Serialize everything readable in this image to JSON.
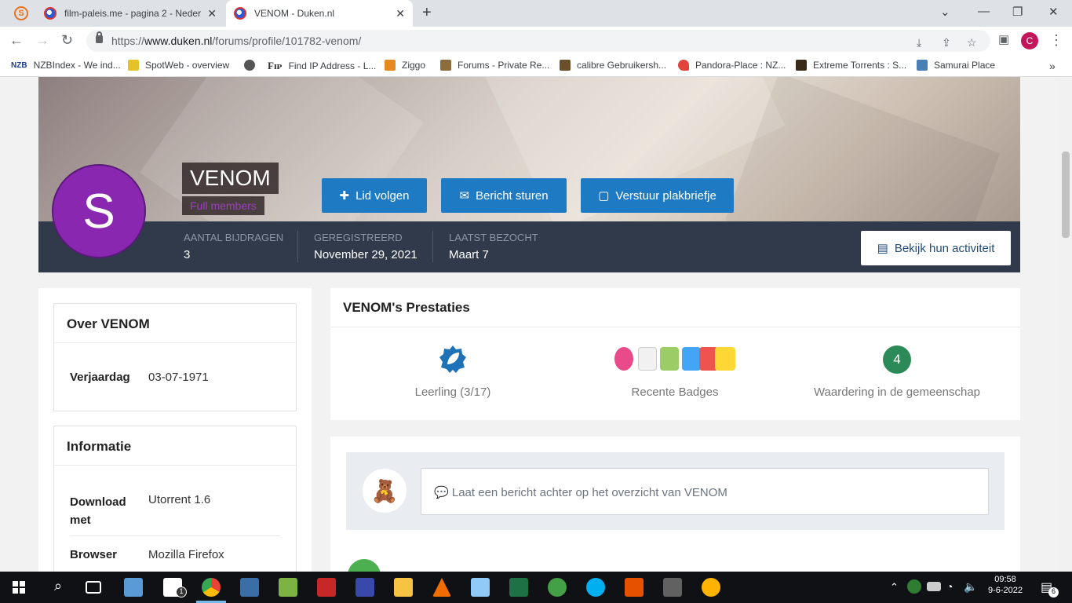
{
  "browser": {
    "tabs": [
      {
        "title": "film-paleis.me - pagina 2 - Neder",
        "active": false
      },
      {
        "title": "VENOM - Duken.nl",
        "active": true
      }
    ],
    "url_prefix": "https://",
    "url_host": "www.duken.nl",
    "url_path": "/forums/profile/101782-venom/",
    "profile_initial": "C",
    "bookmarks": [
      {
        "label": "NZBIndex - We ind...",
        "icon": "nzb-icon",
        "color": "#1a3e8c"
      },
      {
        "label": "SpotWeb - overview",
        "icon": "pencil-icon",
        "color": "#e6c229"
      },
      {
        "label": "",
        "icon": "globe-icon",
        "color": "#555555"
      },
      {
        "label": "Find IP Address - L...",
        "icon": "fip-icon",
        "color": "#333333"
      },
      {
        "label": "Ziggo",
        "icon": "ziggo-icon",
        "color": "#e58a1f"
      },
      {
        "label": "Forums - Private Re...",
        "icon": "forums-icon",
        "color": "#8a6d3b"
      },
      {
        "label": "calibre Gebruikersh...",
        "icon": "books-icon",
        "color": "#6b4f2a"
      },
      {
        "label": "Pandora-Place : NZ...",
        "icon": "heart-icon",
        "color": "#e0443a"
      },
      {
        "label": "Extreme Torrents : S...",
        "icon": "extreme-icon",
        "color": "#3a2a1a"
      },
      {
        "label": "Samurai Place",
        "icon": "samurai-icon",
        "color": "#4a7fb5"
      }
    ]
  },
  "profile": {
    "name": "VENOM",
    "avatar_letter": "S",
    "group": "Full members",
    "buttons": {
      "follow": "Lid volgen",
      "message": "Bericht sturen",
      "sticky": "Verstuur plakbriefje"
    },
    "stats": [
      {
        "label": "Aantal bijdragen",
        "value": "3"
      },
      {
        "label": "Geregistreerd",
        "value": "November 29, 2021"
      },
      {
        "label": "Laatst bezocht",
        "value": "Maart 7"
      }
    ],
    "activity_button": "Bekijk hun activiteit"
  },
  "about": {
    "title": "Over VENOM",
    "birthday_label": "Verjaardag",
    "birthday_value": "03-07-1971"
  },
  "info": {
    "title": "Informatie",
    "rows": [
      {
        "label": "Download met",
        "value": "Utorrent 1.6"
      },
      {
        "label": "Browser",
        "value": "Mozilla Firefox"
      }
    ]
  },
  "achievements": {
    "title": "VENOM's Prestaties",
    "rank_label": "Leerling (3/17)",
    "badges_label": "Recente Badges",
    "reputation_value": "4",
    "reputation_label": "Waardering in de gemeenschap"
  },
  "status": {
    "placeholder": "Laat een bericht achter op het overzicht van VENOM"
  },
  "taskbar": {
    "time": "09:58",
    "date": "9-6-2022",
    "mail_count": "1",
    "notif_count": "6"
  },
  "colors": {
    "primary_button": "#1f7ac4",
    "stats_bar": "#303a4a",
    "avatar": "#8a27b0",
    "group": "#9b3fbf",
    "reputation": "#2b8a57"
  }
}
